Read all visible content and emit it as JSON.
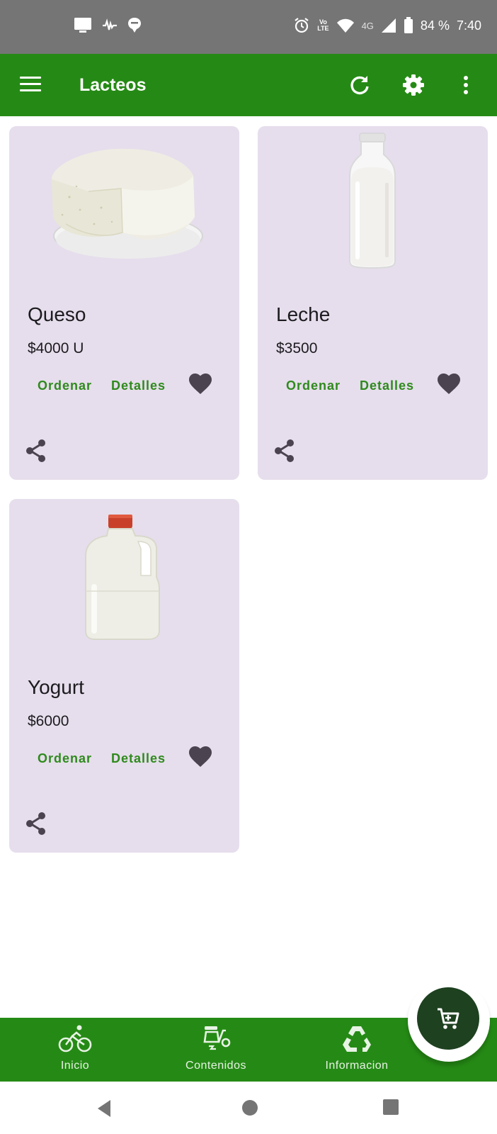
{
  "status_bar": {
    "battery": "84 %",
    "time": "7:40",
    "volte_top": "Vo",
    "volte_bottom": "LTE",
    "network": "4G",
    "icons": [
      "screen-icon",
      "signal-wave-icon",
      "chat-bubble-icon",
      "alarm-icon",
      "volte-icon",
      "wifi-icon",
      "cell-signal-icon",
      "battery-icon"
    ]
  },
  "app_bar": {
    "title": "Lacteos",
    "icons": [
      "menu-icon",
      "refresh-icon",
      "settings-icon",
      "more-vert-icon"
    ],
    "color": "#258a15"
  },
  "products": [
    {
      "name": "Queso",
      "price": "$4000 U",
      "order_label": "Ordenar",
      "details_label": "Detalles",
      "image": "cheese-image"
    },
    {
      "name": "Leche",
      "price": "$3500",
      "order_label": "Ordenar",
      "details_label": "Detalles",
      "image": "milk-bottle-image"
    },
    {
      "name": "Yogurt",
      "price": "$6000",
      "order_label": "Ordenar",
      "details_label": "Detalles",
      "image": "yogurt-jug-image"
    }
  ],
  "bottom_nav": {
    "items": [
      {
        "label": "Inicio",
        "icon": "bicycle-icon"
      },
      {
        "label": "Contenidos",
        "icon": "scooter-icon"
      },
      {
        "label": "Informacion",
        "icon": "recycle-icon"
      }
    ]
  },
  "fab": {
    "icon": "cart-icon"
  },
  "colors": {
    "accent": "#258a15",
    "card": "#e6deec",
    "button_text": "#2f8a1d",
    "fab": "#1e4120"
  }
}
